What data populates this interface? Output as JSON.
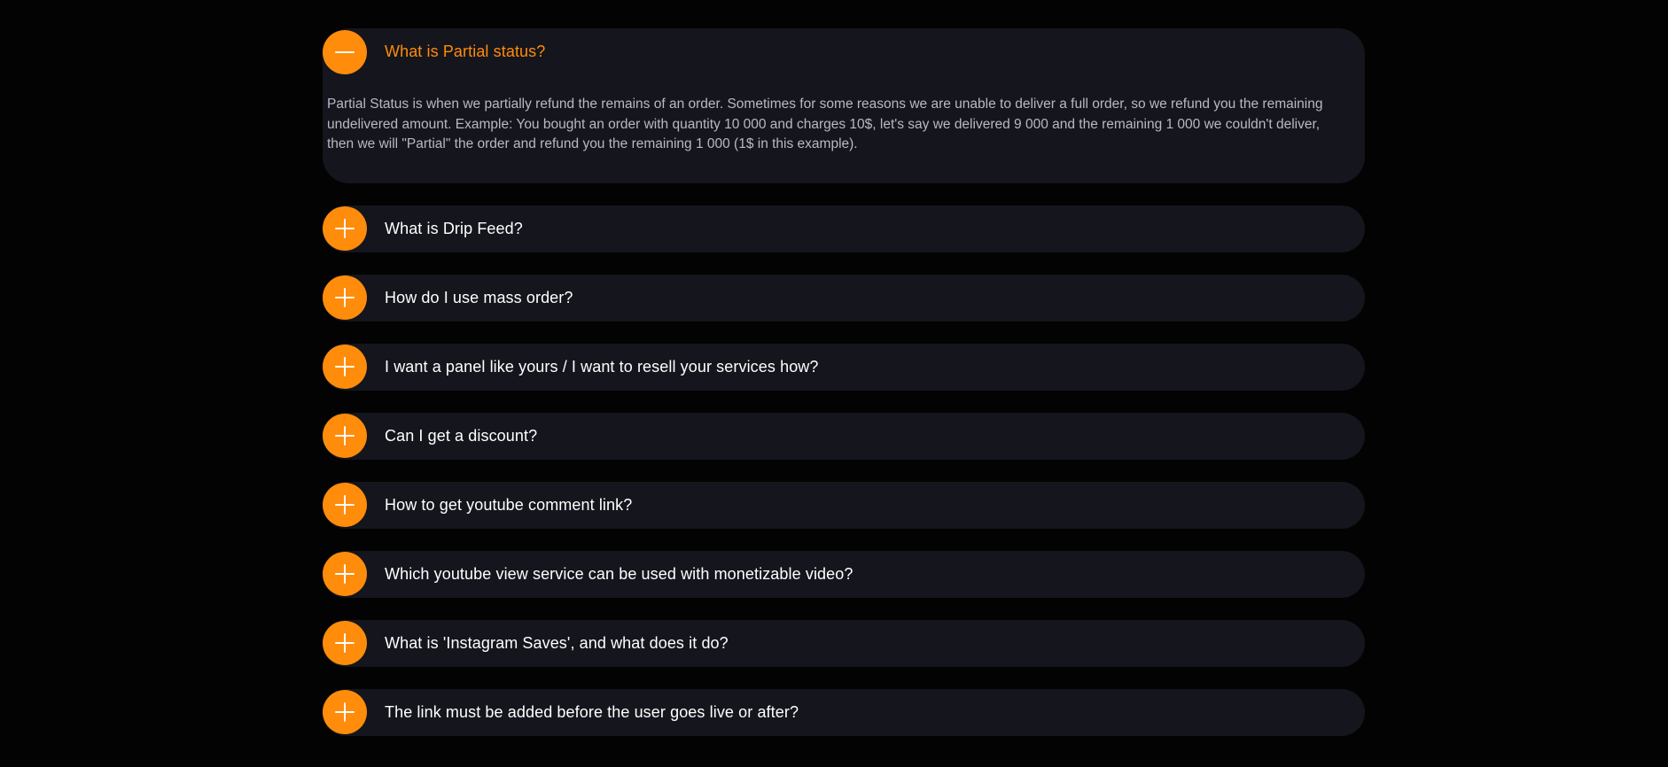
{
  "colors": {
    "background": "#030303",
    "card": "#15151d",
    "accent": "#ff8c0a",
    "question_text": "#ffffff",
    "answer_text": "#b9b9c4"
  },
  "faq": {
    "items": [
      {
        "question": "What is Partial status?",
        "expanded": true,
        "icon": "minus-icon",
        "answer": "Partial Status is when we partially refund the remains of an order. Sometimes for some reasons we are unable to deliver a full order, so we refund you the remaining undelivered amount. Example: You bought an order with quantity 10 000 and charges 10$, let's say we delivered 9 000 and the remaining 1 000 we couldn't deliver, then we will \"Partial\" the order and refund you the remaining 1 000 (1$ in this example)."
      },
      {
        "question": "What is Drip Feed?",
        "expanded": false,
        "icon": "plus-icon"
      },
      {
        "question": "How do I use mass order?",
        "expanded": false,
        "icon": "plus-icon"
      },
      {
        "question": "I want a panel like yours / I want to resell your services how?",
        "expanded": false,
        "icon": "plus-icon"
      },
      {
        "question": "Can I get a discount?",
        "expanded": false,
        "icon": "plus-icon"
      },
      {
        "question": "How to get youtube comment link?",
        "expanded": false,
        "icon": "plus-icon"
      },
      {
        "question": "Which youtube view service can be used with monetizable video?",
        "expanded": false,
        "icon": "plus-icon"
      },
      {
        "question": "What is 'Instagram Saves', and what does it do?",
        "expanded": false,
        "icon": "plus-icon"
      },
      {
        "question": "The link must be added before the user goes live or after?",
        "expanded": false,
        "icon": "plus-icon"
      }
    ]
  }
}
